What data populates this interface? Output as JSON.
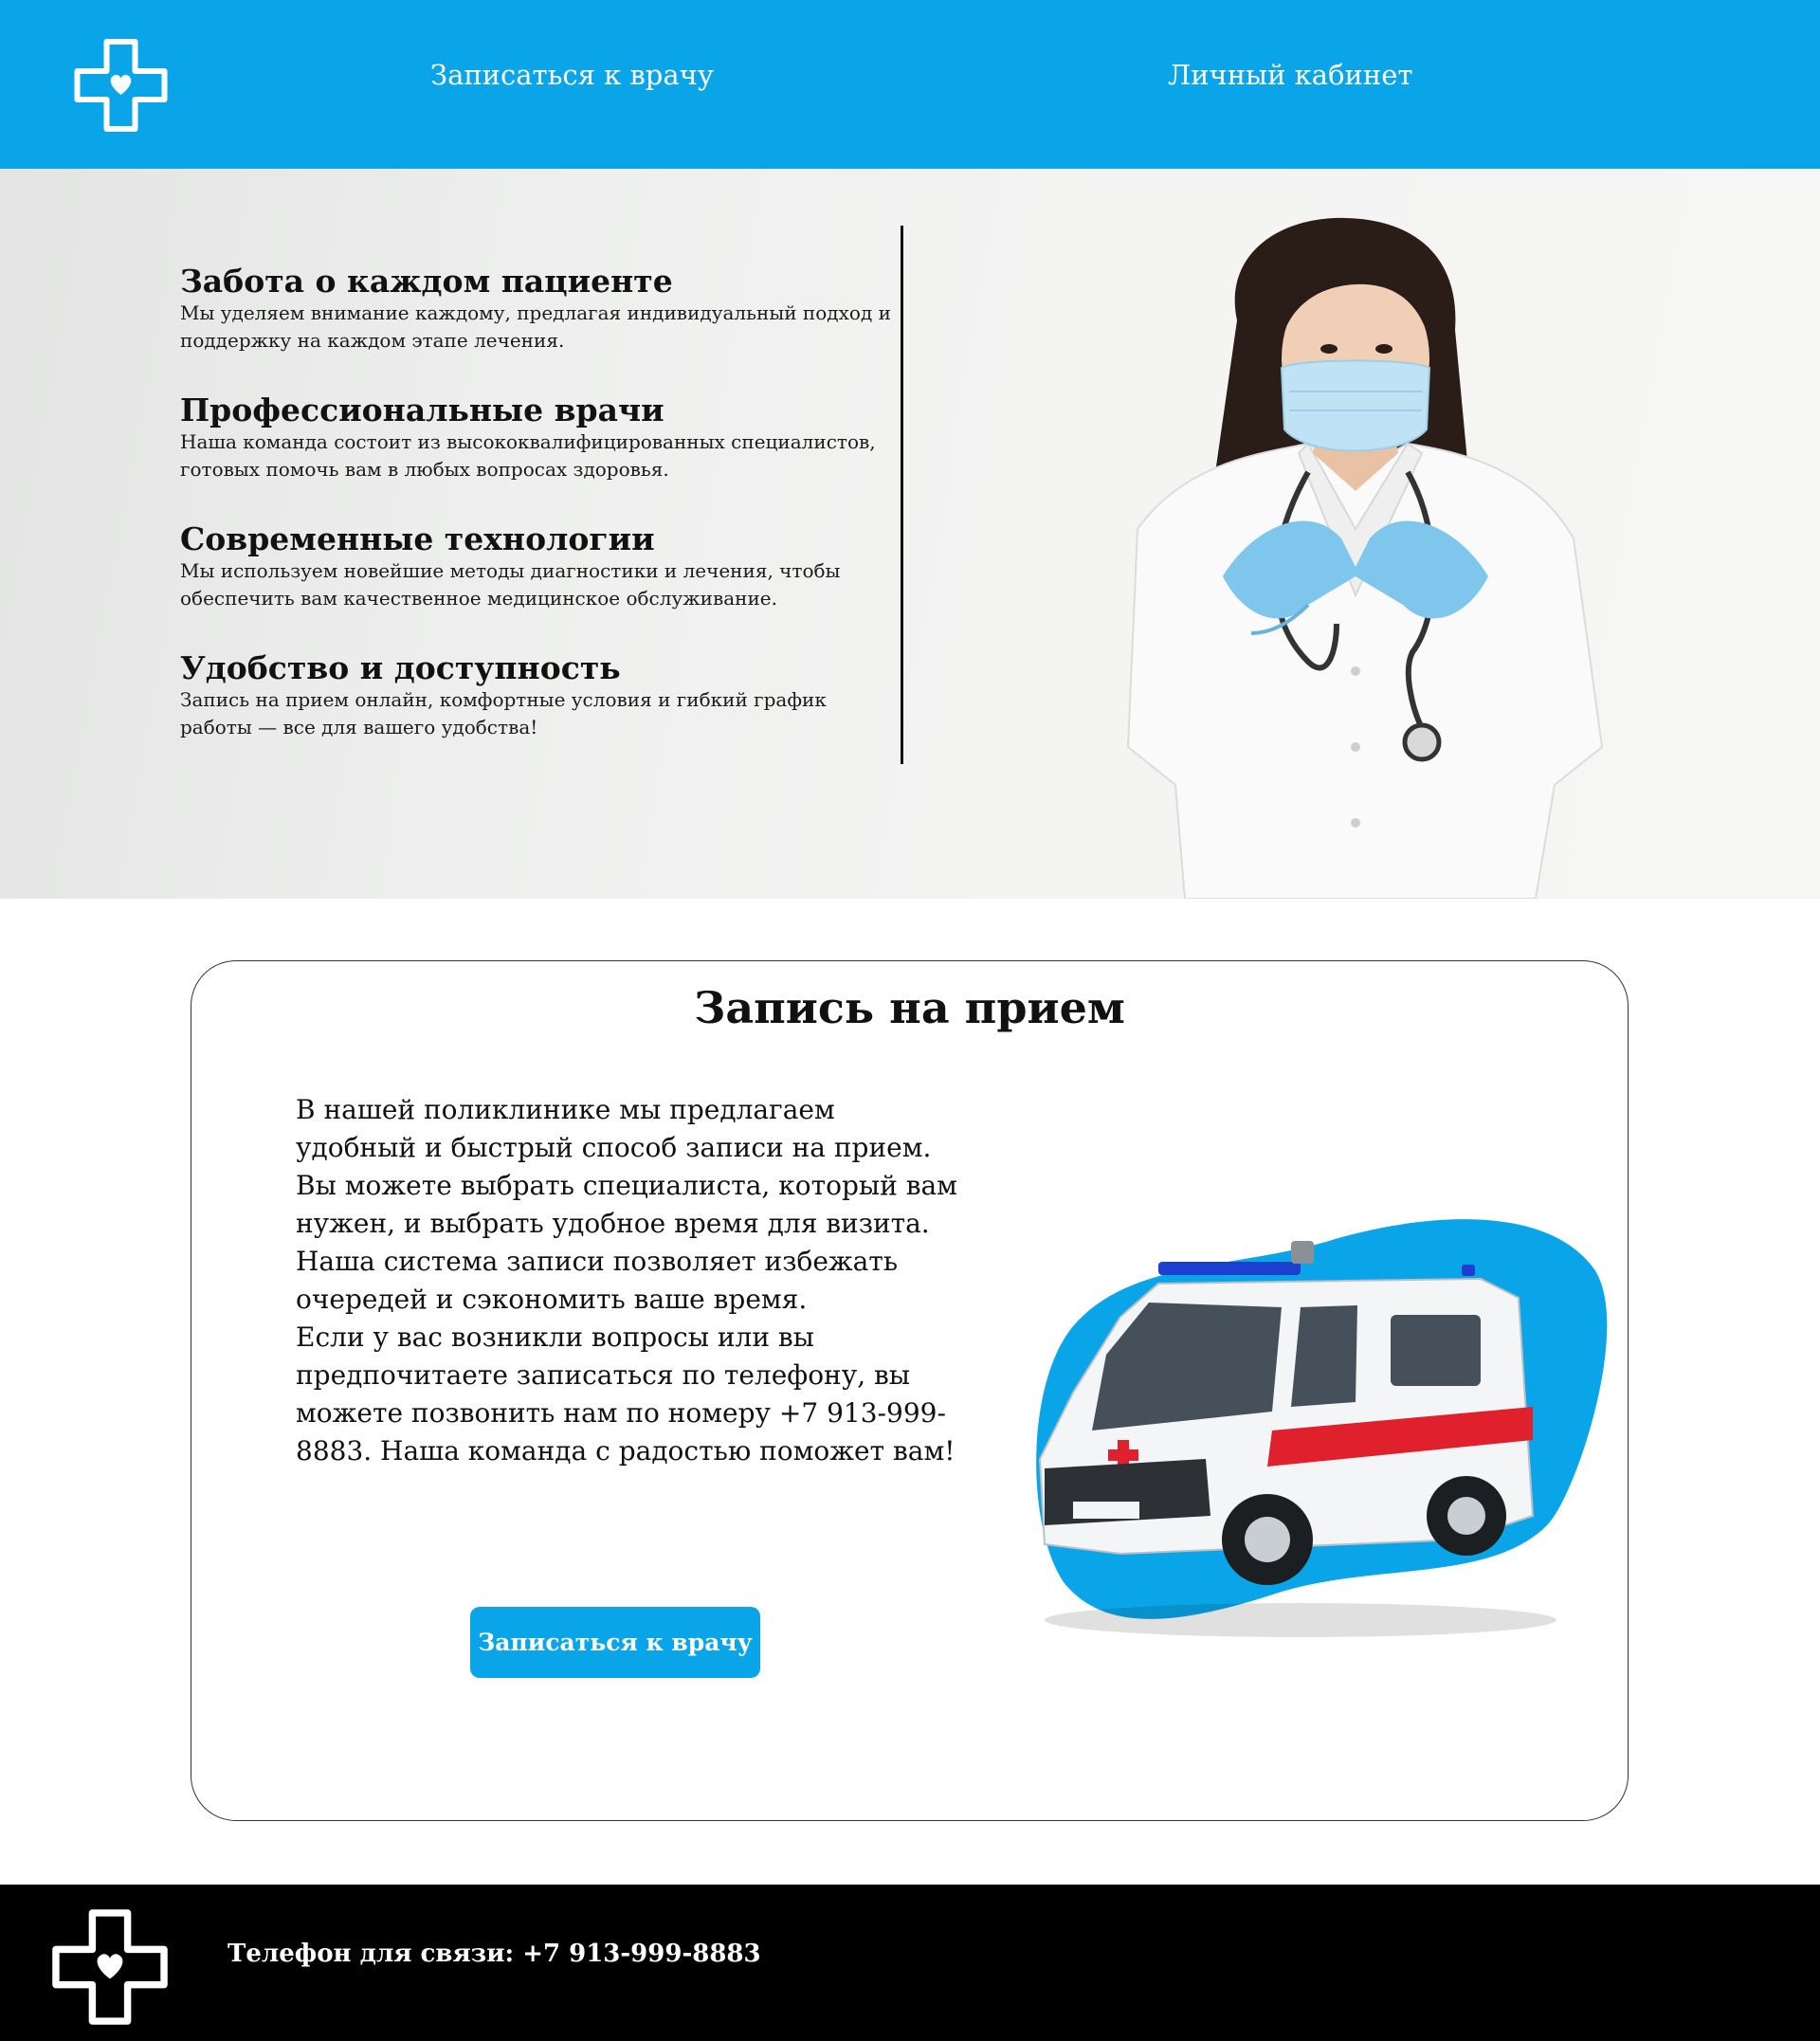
{
  "colors": {
    "brand": "#0aa5e8",
    "footer": "#000000",
    "text": "#111111"
  },
  "header": {
    "logo_icon": "medical-cross-heart-icon",
    "nav": {
      "appointment_label": "Записаться к врачу",
      "cabinet_label": "Личный кабинет"
    }
  },
  "hero": {
    "features": [
      {
        "title": "Забота о каждом пациенте",
        "text": "Мы уделяем внимание каждому, предлагая индивидуальный подход и поддержку на каждом этапе лечения."
      },
      {
        "title": "Профессиональные врачи",
        "text": "Наша команда состоит из высококвалифицированных специалистов, готовых помочь вам в любых вопросах здоровья."
      },
      {
        "title": "Современные технологии",
        "text": "Мы используем новейшие методы диагностики и лечения, чтобы обеспечить вам качественное медицинское обслуживание."
      },
      {
        "title": "Удобство и доступность",
        "text": "Запись на прием онлайн, комфортные условия и гибкий график работы — все для вашего удобства!"
      }
    ]
  },
  "appointment": {
    "title": "Запись на прием",
    "paragraphs": [
      "В нашей поликлинике мы предлагаем удобный и быстрый способ записи на прием. Вы можете выбрать специалиста, который вам нужен, и выбрать удобное время для визита.",
      " Наша система записи позволяет избежать очередей и сэкономить ваше время.",
      "Если у вас возникли вопросы или вы предпочитаете записаться по телефону, вы можете позвонить нам по номеру +7 913-999-8883. Наша команда с радостью поможет вам!"
    ],
    "button_label": "Записаться к врачу"
  },
  "footer": {
    "logo_icon": "medical-cross-heart-icon",
    "phone_text": "Телефон для связи: +7 913-999-8883"
  }
}
